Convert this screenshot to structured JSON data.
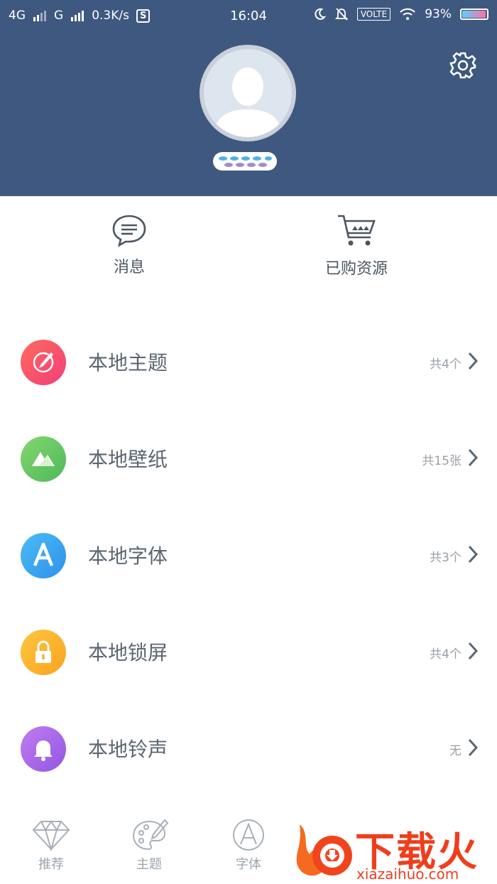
{
  "status_bar": {
    "signal1": "4G",
    "signal2": "G",
    "net_speed": "0.3K/s",
    "app_badge": "S",
    "time": "16:04",
    "volte": "VOLTE",
    "battery": "93%"
  },
  "quick_actions": {
    "messages_label": "消息",
    "purchased_label": "已购资源"
  },
  "local_items": [
    {
      "label": "本地主题",
      "count": "共4个",
      "icon": "brush-icon",
      "color": "#f0506e"
    },
    {
      "label": "本地壁纸",
      "count": "共15张",
      "icon": "mountain-icon",
      "color": "#6cc35f"
    },
    {
      "label": "本地字体",
      "count": "共3个",
      "icon": "letter-a-icon",
      "color": "#3aa7ef"
    },
    {
      "label": "本地锁屏",
      "count": "共4个",
      "icon": "lock-icon",
      "color": "#fbb32e"
    },
    {
      "label": "本地铃声",
      "count": "无",
      "icon": "bell-icon",
      "color": "#a66ee6"
    }
  ],
  "tabs": [
    {
      "label": "推荐",
      "icon": "diamond-icon"
    },
    {
      "label": "主题",
      "icon": "palette-icon"
    },
    {
      "label": "字体",
      "icon": "font-a-icon"
    }
  ],
  "watermark": {
    "brand": "下载火",
    "url": "xiazaihuo.com"
  },
  "colors": {
    "header_bg": "#3f5880",
    "text_primary": "#5a6670",
    "text_secondary": "#9aa0a6"
  }
}
